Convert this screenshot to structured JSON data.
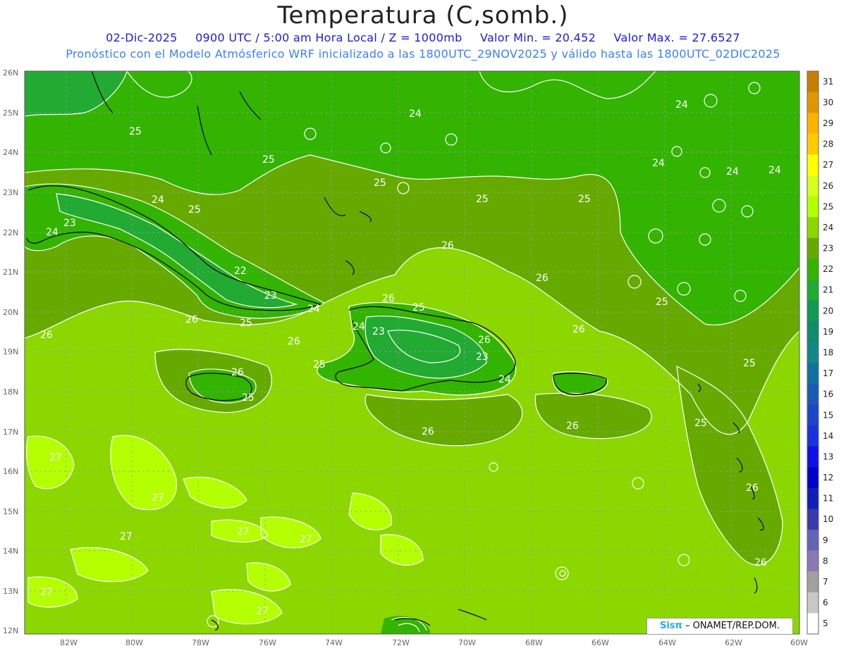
{
  "header": {
    "title": "Temperatura (C,somb.)",
    "info_date": "02-Dic-2025",
    "info_time": "0900 UTC / 5:00 am Hora Local / Z = 1000mb",
    "info_min": "Valor Min. = 20.452",
    "info_max": "Valor Max. = 27.6527",
    "forecast_line": "Pronóstico con el Modelo Atmósferico WRF inicializado a las 1800UTC_29NOV2025 y válido hasta las  1800UTC_02DIC2025"
  },
  "axes": {
    "lat_labels": [
      "26N",
      "25N",
      "24N",
      "23N",
      "22N",
      "21N",
      "20N",
      "19N",
      "18N",
      "17N",
      "16N",
      "15N",
      "14N",
      "13N",
      "12N"
    ],
    "lon_labels": [
      "82W",
      "80W",
      "78W",
      "76W",
      "74W",
      "72W",
      "70W",
      "68W",
      "66W",
      "64W",
      "62W",
      "60W"
    ]
  },
  "colorbar": {
    "labels": [
      "31",
      "30",
      "29",
      "28",
      "27",
      "26",
      "25",
      "24",
      "23",
      "22",
      "21",
      "20",
      "19",
      "18",
      "17",
      "16",
      "15",
      "14",
      "13",
      "12",
      "11",
      "10",
      "9",
      "8",
      "7",
      "6",
      "5"
    ],
    "colors": [
      "#c87f00",
      "#e19600",
      "#ffb300",
      "#ffcc00",
      "#ffff00",
      "#d7ff1e",
      "#b4ff00",
      "#8cd700",
      "#66aa00",
      "#33b400",
      "#22aa33",
      "#119955",
      "#0f8c6e",
      "#118888",
      "#1170a0",
      "#1a5ab4",
      "#1a46c8",
      "#1a32dc",
      "#1010e6",
      "#0000c8",
      "#1020b4",
      "#3a3aaa",
      "#6464b4",
      "#8c78b4",
      "#a0a0a0",
      "#c8c8c8",
      "#ffffff"
    ]
  },
  "contour_labels": {
    "top_right_a": "24",
    "top_right_b": "24",
    "top_right_c": "24",
    "top_right_d": "24",
    "center_top": "24",
    "center_top_b": "25",
    "center_b": "25",
    "center_c": "25",
    "center_d": "25",
    "cuba_w1": "24",
    "cuba_w2": "23",
    "cuba_w3": "24",
    "cuba_w4": "25",
    "cuba_n": "25",
    "cuba_mid_a": "22",
    "cuba_mid_b": "23",
    "cuba_mid_c": "24",
    "cuba_e": "25",
    "sea_w": "26",
    "sea_mid": "26",
    "bah_26": "26",
    "bah_26b": "26",
    "hisp_w": "24",
    "hisp_a": "23",
    "hisp_n": "25",
    "hisp_e1": "26",
    "hisp_e2": "23",
    "hisp_e3": "24",
    "hisp_s": "25",
    "hisp_sw": "26",
    "jam_n": "26",
    "jam_s": "25",
    "pr_e": "26",
    "east_a": "25",
    "east_b": "25",
    "east_c": "25",
    "east_d": "26",
    "east_e": "26",
    "carib_a": "26",
    "carib_b": "26",
    "antilles_a": "26",
    "s_27a": "27",
    "s_27b": "27",
    "s_27c": "27",
    "s_27d": "27",
    "s_27e": "27",
    "s_27f": "27",
    "s_27g": "27"
  },
  "credit": {
    "brand": "Sisπ",
    "text": "– ONAMET/REP.DOM."
  }
}
